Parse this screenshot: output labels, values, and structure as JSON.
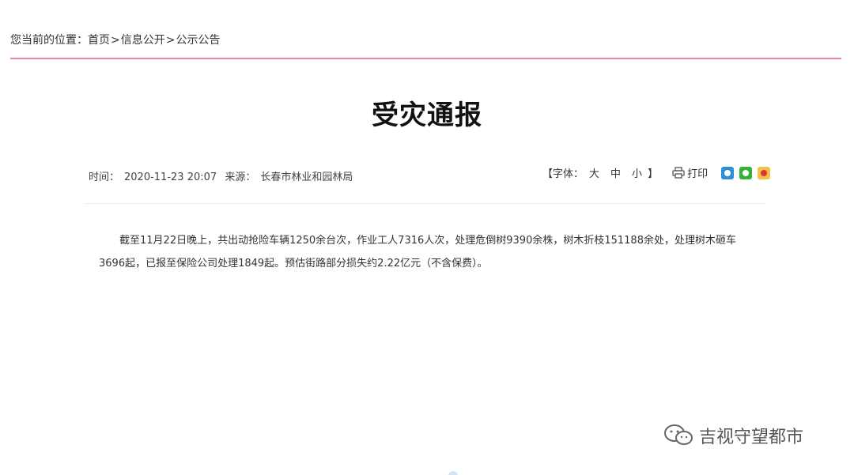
{
  "breadcrumb": {
    "prefix": "您当前的位置：",
    "home": "首页",
    "sep1": ">",
    "section": "信息公开",
    "sep2": ">",
    "current": "公示公告"
  },
  "article": {
    "title": "受灾通报",
    "time_label": "时间：",
    "time_value": "2020-11-23 20:07",
    "source_label": "来源：",
    "source_value": "长春市林业和园林局",
    "body": "截至11月22日晚上，共出动抢险车辆1250余台次，作业工人7316人次，处理危倒树9390余株，树木折枝151188余处，处理树木砸车3696起，已报至保险公司处理1849起。预估街路部分损失约2.22亿元（不含保费）。"
  },
  "tools": {
    "font_open": "【字体：",
    "font_large": "大",
    "font_medium": "中",
    "font_small": "小",
    "font_close": "】",
    "print_label": "打印",
    "share_icons": [
      "qq-icon",
      "wechat-icon",
      "weibo-icon"
    ]
  },
  "watermark": {
    "text": "吉视守望都市"
  },
  "colors": {
    "accent_rule": "#e9889b",
    "qq": "#2d8fd8",
    "wechat": "#34b233",
    "weibo": "#f0c24a"
  }
}
